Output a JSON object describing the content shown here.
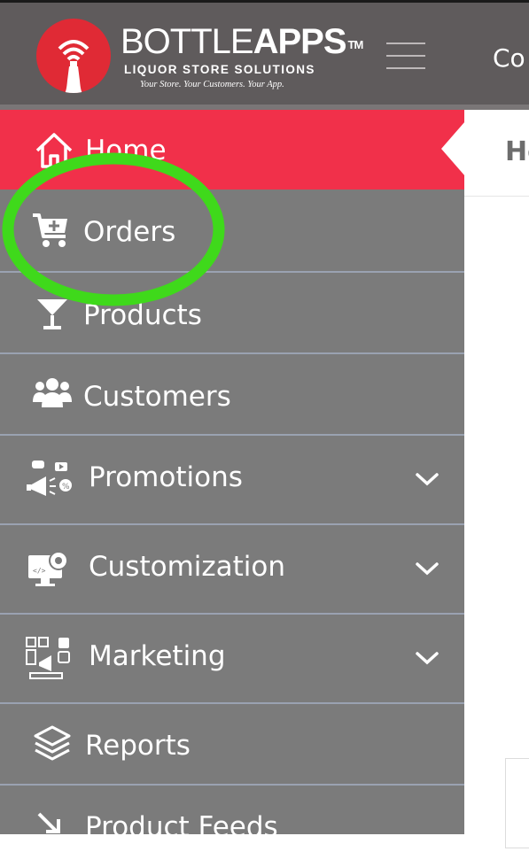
{
  "brand": {
    "name_light": "BOTTLE",
    "name_bold": "APPS",
    "trademark": "TM",
    "tagline": "LIQUOR STORE SOLUTIONS",
    "subtag": "Your Store. Your Customers. Your App."
  },
  "header": {
    "link_text": "Co"
  },
  "sidebar": {
    "items": [
      {
        "label": "Home",
        "icon": "home-icon",
        "active": true
      },
      {
        "label": "Orders",
        "icon": "cart-plus-icon"
      },
      {
        "label": "Products",
        "icon": "cocktail-glass-icon"
      },
      {
        "label": "Customers",
        "icon": "users-icon"
      },
      {
        "label": "Promotions",
        "icon": "megaphone-icon",
        "expandable": true
      },
      {
        "label": "Customization",
        "icon": "gear-monitor-icon",
        "expandable": true
      },
      {
        "label": "Marketing",
        "icon": "marketing-icon",
        "expandable": true
      },
      {
        "label": "Reports",
        "icon": "layers-icon"
      },
      {
        "label": "Product Feeds",
        "icon": "download-feed-icon"
      }
    ]
  },
  "content": {
    "title": "Ho"
  },
  "colors": {
    "header_bg": "#5f5b5c",
    "sidebar_bg": "#7b7b7b",
    "active_bg": "#f1304a",
    "brand_red": "#e02a35",
    "annotation": "#3fd91b"
  }
}
